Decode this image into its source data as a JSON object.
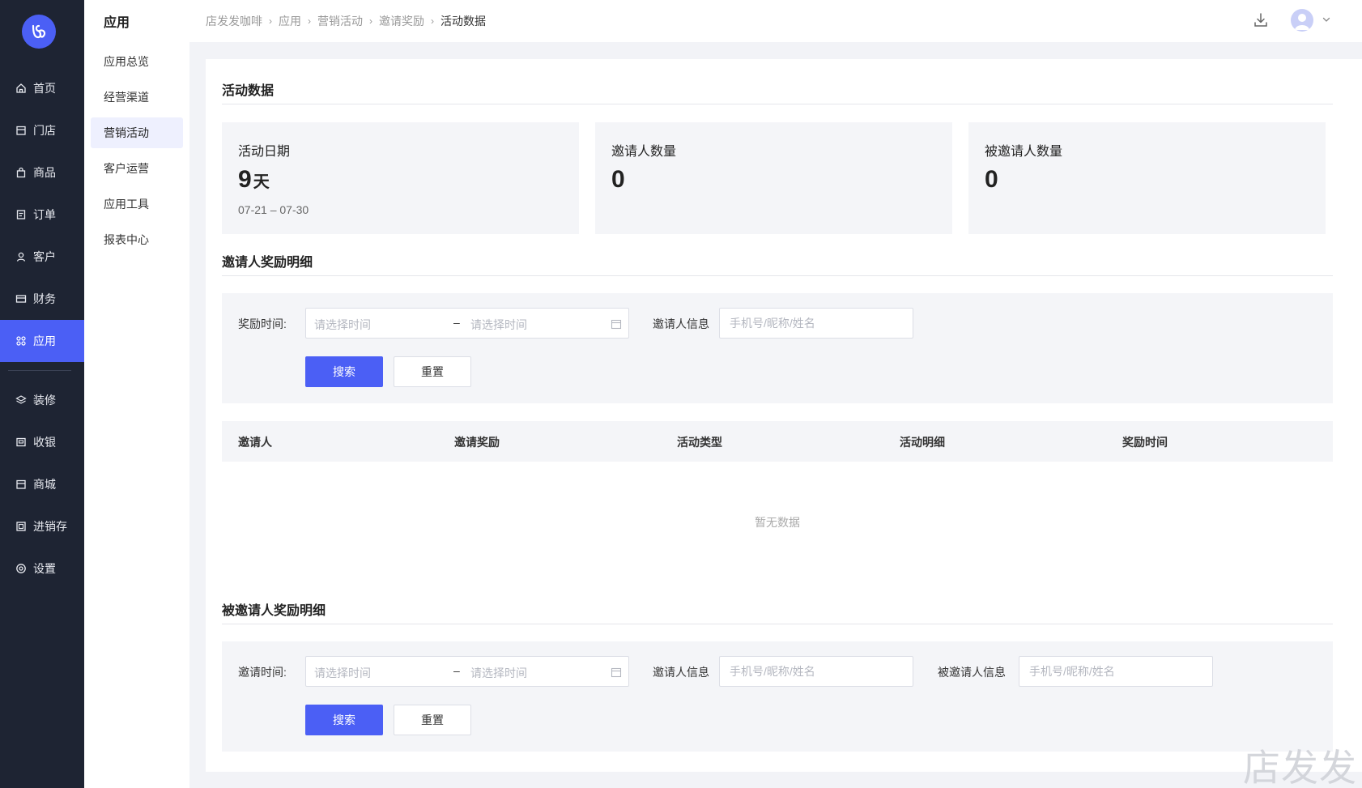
{
  "sidebar": {
    "items": [
      {
        "label": "首页",
        "icon": "home-icon"
      },
      {
        "label": "门店",
        "icon": "store-icon"
      },
      {
        "label": "商品",
        "icon": "bag-icon"
      },
      {
        "label": "订单",
        "icon": "order-icon"
      },
      {
        "label": "客户",
        "icon": "user-icon"
      },
      {
        "label": "财务",
        "icon": "card-icon"
      },
      {
        "label": "应用",
        "icon": "apps-icon"
      },
      {
        "label": "装修",
        "icon": "layers-icon"
      },
      {
        "label": "收银",
        "icon": "cashier-icon"
      },
      {
        "label": "商城",
        "icon": "mall-icon"
      },
      {
        "label": "进销存",
        "icon": "inventory-icon"
      },
      {
        "label": "设置",
        "icon": "settings-icon"
      }
    ],
    "active_index": 6
  },
  "subnav": {
    "title": "应用",
    "items": [
      "应用总览",
      "经营渠道",
      "营销活动",
      "客户运营",
      "应用工具",
      "报表中心"
    ],
    "active_index": 2
  },
  "breadcrumb": [
    "店发发咖啡",
    "应用",
    "营销活动",
    "邀请奖励",
    "活动数据"
  ],
  "main": {
    "title": "活动数据",
    "stats": [
      {
        "label": "活动日期",
        "value": "9",
        "unit": "天",
        "range": "07-21 – 07-30"
      },
      {
        "label": "邀请人数量",
        "value": "0"
      },
      {
        "label": "被邀请人数量",
        "value": "0"
      }
    ],
    "inviter_section": {
      "title": "邀请人奖励明细",
      "time_label": "奖励时间:",
      "start_placeholder": "请选择时间",
      "dash": "–",
      "end_placeholder": "请选择时间",
      "info_label": "邀请人信息",
      "info_placeholder": "手机号/昵称/姓名",
      "search_label": "搜索",
      "reset_label": "重置",
      "columns": [
        "邀请人",
        "邀请奖励",
        "活动类型",
        "活动明细",
        "奖励时间"
      ],
      "empty_text": "暂无数据"
    },
    "invitee_section": {
      "title": "被邀请人奖励明细",
      "time_label": "邀请时间:",
      "start_placeholder": "请选择时间",
      "dash": "–",
      "end_placeholder": "请选择时间",
      "inviter_info_label": "邀请人信息",
      "inviter_info_placeholder": "手机号/昵称/姓名",
      "invitee_info_label": "被邀请人信息",
      "invitee_info_placeholder": "手机号/昵称/姓名",
      "search_label": "搜索",
      "reset_label": "重置"
    }
  },
  "watermark": "店发发",
  "colors": {
    "primary": "#4b5ff5",
    "sidebar_bg": "#1e2433",
    "panel_bg": "#f4f5f8"
  }
}
